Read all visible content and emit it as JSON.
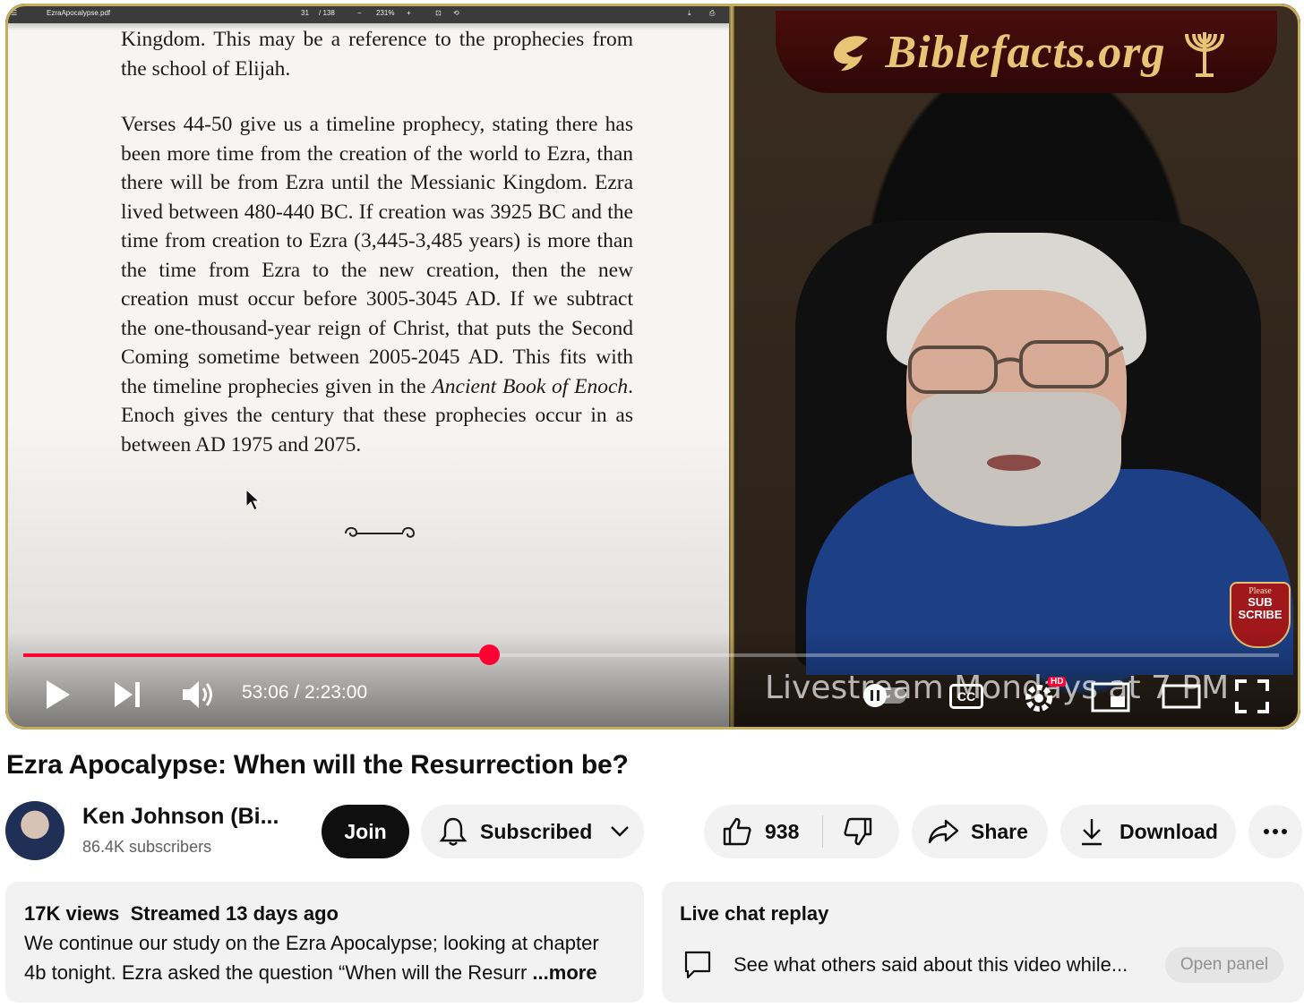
{
  "pdf_viewer": {
    "filename": "EzraApocalypse.pdf",
    "page_current": "31",
    "page_total": "/ 138",
    "zoom": "231%",
    "paragraph_1": "Kingdom. This may be a reference to the prophecies from the school of Elijah.",
    "paragraph_2_pre": "Verses 44-50 give us a timeline prophecy, stating there has been more time from the creation of the world to Ezra, than there will be from Ezra until the Messianic Kingdom. Ezra lived between 480-440 BC. If creation was 3925 BC and the time from creation to Ezra (3,445-3,485 years) is more than the time from Ezra to the new creation, then the new creation must occur before 3005-3045 AD. If we subtract the one-thousand-year reign of Christ, that puts the Second Coming sometime between 2005-2045 AD. This fits with the timeline prophecies given in the ",
    "paragraph_2_italic": "Ancient Book of Enoch",
    "paragraph_2_post": ". Enoch gives the century that these prophecies occur in as between AD 1975 and 2075."
  },
  "video": {
    "banner": "Biblefacts.org",
    "subscribe_badge_top": "Please",
    "subscribe_badge_line1": "SUB",
    "subscribe_badge_line2": "SCRIBE",
    "watermark": "Livestream Mondays at 7 PM",
    "time_display": "53:06 / 2:23:00",
    "progress_fraction": 0.371,
    "cc_label": "CC",
    "hd_badge": "HD"
  },
  "title": "Ezra Apocalypse: When will the Resurrection be?",
  "channel": {
    "name": "Ken Johnson (Bi...",
    "subscribers": "86.4K subscribers"
  },
  "actions": {
    "join": "Join",
    "subscribed": "Subscribed",
    "likes": "938",
    "share": "Share",
    "download": "Download"
  },
  "description": {
    "meta": "17K views  Streamed 13 days ago",
    "line1": "We continue our study on the Ezra Apocalypse; looking at chapter",
    "line2": "4b tonight. Ezra asked the question “When will the  Resurr",
    "more": "...more"
  },
  "chat": {
    "title": "Live chat replay",
    "text": "See what others said about this video while...",
    "button": "Open panel"
  },
  "colors": {
    "progress": "#ff0033",
    "banner_gold": "#e8c574",
    "shirt_blue": "#1d3f86"
  }
}
